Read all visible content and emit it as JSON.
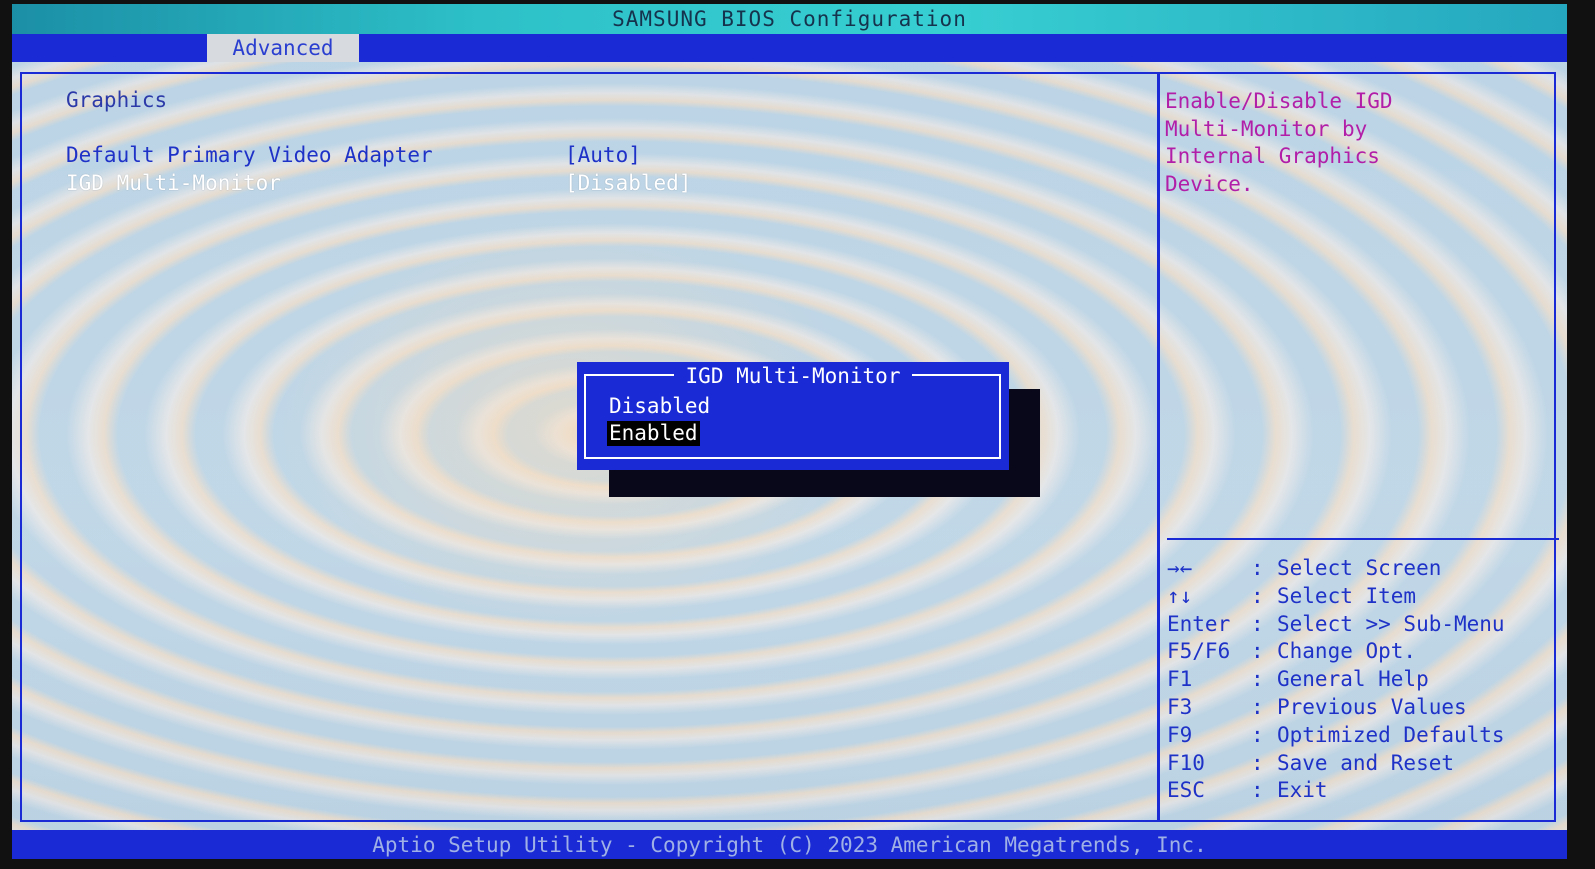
{
  "window": {
    "title": "SAMSUNG BIOS Configuration"
  },
  "tabs": [
    {
      "label": "Advanced",
      "active": true
    }
  ],
  "main": {
    "section_title": "Graphics",
    "settings": [
      {
        "label": "Default Primary Video Adapter",
        "value": "[Auto]",
        "highlighted": false
      },
      {
        "label": "IGD Multi-Monitor",
        "value": "[Disabled]",
        "highlighted": true
      }
    ]
  },
  "help": {
    "lines": [
      "Enable/Disable IGD",
      "Multi-Monitor by",
      "Internal Graphics",
      "Device."
    ]
  },
  "keys": [
    {
      "key": "→←",
      "sep": ":",
      "action": "Select Screen"
    },
    {
      "key": "↑↓",
      "sep": ":",
      "action": "Select Item"
    },
    {
      "key": "Enter",
      "sep": ":",
      "action": "Select >> Sub-Menu"
    },
    {
      "key": "F5/F6",
      "sep": ":",
      "action": "Change Opt."
    },
    {
      "key": "F1",
      "sep": ":",
      "action": "General Help"
    },
    {
      "key": "F3",
      "sep": ":",
      "action": "Previous Values"
    },
    {
      "key": "F9",
      "sep": ":",
      "action": "Optimized Defaults"
    },
    {
      "key": "F10",
      "sep": ":",
      "action": "Save and Reset"
    },
    {
      "key": "ESC",
      "sep": ":",
      "action": "Exit"
    }
  ],
  "popup": {
    "title": "IGD Multi-Monitor",
    "options": [
      {
        "label": "Disabled",
        "selected": false
      },
      {
        "label": "Enabled",
        "selected": true
      }
    ]
  },
  "footer": {
    "text": "Aptio Setup Utility - Copyright (C) 2023 American Megatrends, Inc."
  },
  "colors": {
    "bios_blue": "#1a2ad4",
    "help_magenta": "#b21ea8",
    "title_cyan": "#2dc0c8"
  }
}
